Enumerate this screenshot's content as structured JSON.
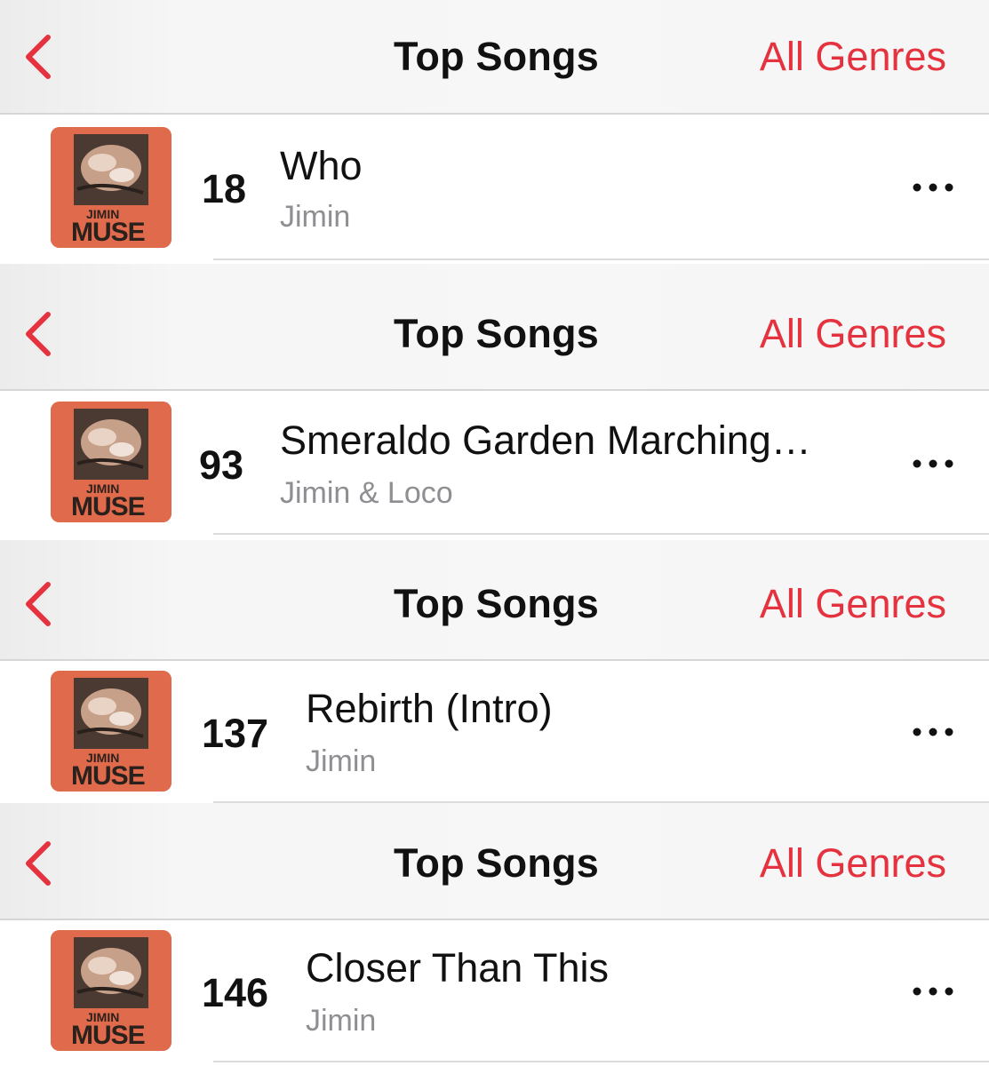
{
  "sections": [
    {
      "header": {
        "title": "Top Songs",
        "genres_label": "All Genres",
        "back_icon": "chevron-left-icon"
      },
      "song": {
        "rank": "18",
        "title": "Who",
        "artist": "Jimin",
        "album_art_text_small": "JIMIN",
        "album_art_text_large": "MUSE"
      }
    },
    {
      "header": {
        "title": "Top Songs",
        "genres_label": "All Genres",
        "back_icon": "chevron-left-icon"
      },
      "song": {
        "rank": "93",
        "title": "Smeraldo Garden Marching…",
        "artist": "Jimin & Loco",
        "album_art_text_small": "JIMIN",
        "album_art_text_large": "MUSE"
      }
    },
    {
      "header": {
        "title": "Top Songs",
        "genres_label": "All Genres",
        "back_icon": "chevron-left-icon"
      },
      "song": {
        "rank": "137",
        "title": "Rebirth (Intro)",
        "artist": "Jimin",
        "album_art_text_small": "JIMIN",
        "album_art_text_large": "MUSE"
      }
    },
    {
      "header": {
        "title": "Top Songs",
        "genres_label": "All Genres",
        "back_icon": "chevron-left-icon"
      },
      "song": {
        "rank": "146",
        "title": "Closer Than This",
        "artist": "Jimin",
        "album_art_text_small": "JIMIN",
        "album_art_text_large": "MUSE"
      }
    }
  ],
  "colors": {
    "accent": "#e5323f",
    "artwork_background": "#e06a4c",
    "secondary_text": "#8e8e93"
  }
}
